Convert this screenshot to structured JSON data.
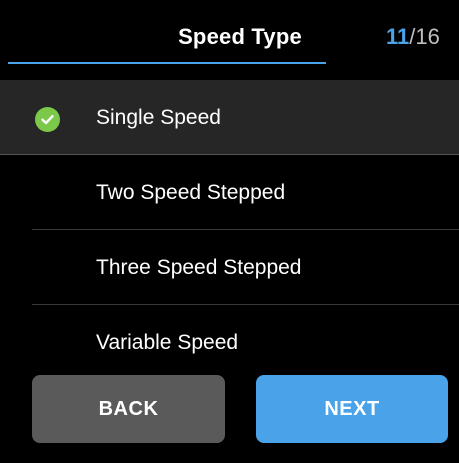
{
  "header": {
    "title": "Speed Type",
    "step_current": "11",
    "step_separator": "/",
    "step_total": "16"
  },
  "options": [
    {
      "label": "Single Speed",
      "selected": true
    },
    {
      "label": "Two Speed Stepped",
      "selected": false
    },
    {
      "label": "Three Speed Stepped",
      "selected": false
    },
    {
      "label": "Variable Speed",
      "selected": false
    }
  ],
  "buttons": {
    "back_label": "BACK",
    "next_label": "NEXT"
  },
  "colors": {
    "accent": "#4aa3e8",
    "check": "#7bc84a",
    "back_button": "#5a5a5a",
    "selected_row": "#262626"
  },
  "icons": {
    "selected": "check-circle-icon"
  }
}
